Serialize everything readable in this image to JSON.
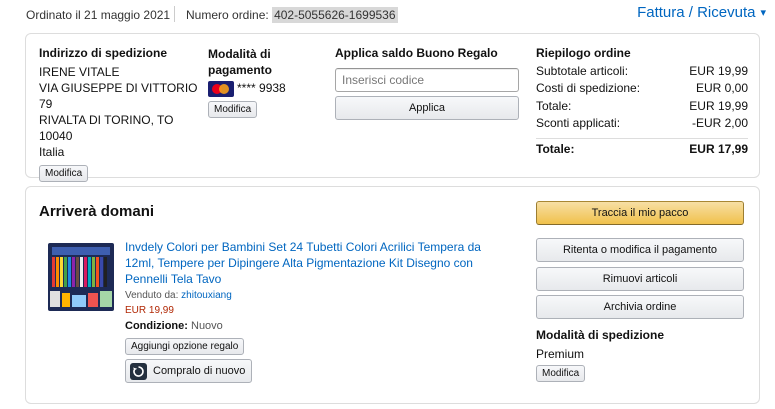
{
  "header": {
    "order_date": "Ordinato il 21 maggio 2021",
    "order_number_label": "Numero ordine:",
    "order_number": "402-5055626-1699536",
    "invoice_link": "Fattura / Ricevuta",
    "invoice_icon": "chevron-down-icon"
  },
  "shipping_address": {
    "heading": "Indirizzo di spedizione",
    "lines": [
      "IRENE VITALE",
      "VIA GIUSEPPE DI VITTORIO 79",
      "RIVALTA DI TORINO, TO 10040",
      "Italia"
    ],
    "edit_label": "Modifica"
  },
  "payment": {
    "heading": "Modalità di pagamento",
    "card_icon": "mastercard-icon",
    "card_number": "**** 9938",
    "edit_label": "Modifica"
  },
  "gift_card": {
    "heading": "Applica saldo Buono Regalo",
    "placeholder": "Inserisci codice",
    "apply_label": "Applica"
  },
  "summary": {
    "heading": "Riepilogo ordine",
    "rows": [
      {
        "label": "Subtotale articoli:",
        "value": "EUR 19,99"
      },
      {
        "label": "Costi di spedizione:",
        "value": "EUR 0,00"
      },
      {
        "label": "Totale:",
        "value": "EUR 19,99"
      },
      {
        "label": "Sconti applicati:",
        "value": "-EUR 2,00"
      }
    ],
    "grand_total_label": "Totale:",
    "grand_total_value": "EUR 17,99"
  },
  "shipment": {
    "status": "Arriverà domani",
    "product_title": "Invdely Colori per Bambini Set 24 Tubetti Colori Acrilici Tempera da 12ml, Tempere per Dipingere Alta Pigmentazione Kit Disegno con Pennelli Tela Tavo",
    "sold_by_label": "Venduto da:",
    "seller": "zhitouxiang",
    "price": "EUR 19,99",
    "condition_label": "Condizione:",
    "condition_value": "Nuovo",
    "gift_option_label": "Aggiungi opzione regalo",
    "buy_again_label": "Compralo di nuovo",
    "buy_again_icon": "buy-again-icon"
  },
  "actions": {
    "track": "Traccia il mio pacco",
    "retry_payment": "Ritenta o modifica il pagamento",
    "remove_items": "Rimuovi articoli",
    "archive": "Archivia ordine"
  },
  "shipping_method": {
    "heading": "Modalità di spedizione",
    "value": "Premium",
    "edit_label": "Modifica"
  },
  "colors": {
    "link": "#0066c0",
    "price": "#b12704",
    "primary_button": "#f0c14b"
  }
}
